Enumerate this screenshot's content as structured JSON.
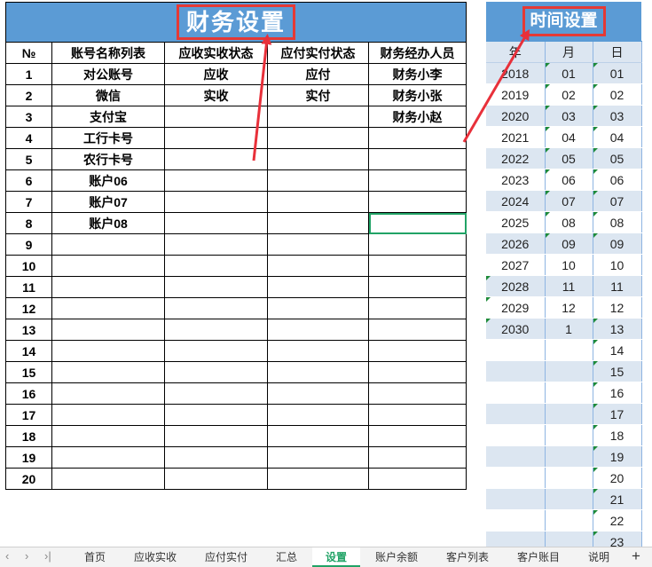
{
  "finance": {
    "title": "财务设置",
    "headers": [
      "№",
      "账号名称列表",
      "应收实收状态",
      "应付实付状态",
      "财务经办人员"
    ],
    "rows": [
      [
        "1",
        "对公账号",
        "应收",
        "应付",
        "财务小李"
      ],
      [
        "2",
        "微信",
        "实收",
        "实付",
        "财务小张"
      ],
      [
        "3",
        "支付宝",
        "",
        "",
        "财务小赵"
      ],
      [
        "4",
        "工行卡号",
        "",
        "",
        ""
      ],
      [
        "5",
        "农行卡号",
        "",
        "",
        ""
      ],
      [
        "6",
        "账户06",
        "",
        "",
        ""
      ],
      [
        "7",
        "账户07",
        "",
        "",
        ""
      ],
      [
        "8",
        "账户08",
        "",
        "",
        ""
      ],
      [
        "9",
        "",
        "",
        "",
        ""
      ],
      [
        "10",
        "",
        "",
        "",
        ""
      ],
      [
        "11",
        "",
        "",
        "",
        ""
      ],
      [
        "12",
        "",
        "",
        "",
        ""
      ],
      [
        "13",
        "",
        "",
        "",
        ""
      ],
      [
        "14",
        "",
        "",
        "",
        ""
      ],
      [
        "15",
        "",
        "",
        "",
        ""
      ],
      [
        "16",
        "",
        "",
        "",
        ""
      ],
      [
        "17",
        "",
        "",
        "",
        ""
      ],
      [
        "18",
        "",
        "",
        "",
        ""
      ],
      [
        "19",
        "",
        "",
        "",
        ""
      ],
      [
        "20",
        "",
        "",
        "",
        ""
      ]
    ]
  },
  "time": {
    "title": "时间设置",
    "headers": [
      "年",
      "月",
      "日"
    ],
    "rows": [
      [
        "2018",
        "01",
        "01"
      ],
      [
        "2019",
        "02",
        "02"
      ],
      [
        "2020",
        "03",
        "03"
      ],
      [
        "2021",
        "04",
        "04"
      ],
      [
        "2022",
        "05",
        "05"
      ],
      [
        "2023",
        "06",
        "06"
      ],
      [
        "2024",
        "07",
        "07"
      ],
      [
        "2025",
        "08",
        "08"
      ],
      [
        "2026",
        "09",
        "09"
      ],
      [
        "2027",
        "10",
        "10"
      ],
      [
        "2028",
        "11",
        "11"
      ],
      [
        "2029",
        "12",
        "12"
      ],
      [
        "2030",
        "1",
        "13"
      ],
      [
        "",
        "",
        "14"
      ],
      [
        "",
        "",
        "15"
      ],
      [
        "",
        "",
        "16"
      ],
      [
        "",
        "",
        "17"
      ],
      [
        "",
        "",
        "18"
      ],
      [
        "",
        "",
        "19"
      ],
      [
        "",
        "",
        "20"
      ],
      [
        "",
        "",
        "21"
      ],
      [
        "",
        "",
        "22"
      ],
      [
        "",
        "",
        "23"
      ]
    ]
  },
  "sheet_tabs": [
    "首页",
    "应收实收",
    "应付实付",
    "汇总",
    "设置",
    "账户余额",
    "客户列表",
    "客户账目",
    "说明"
  ],
  "active_tab": "设置",
  "add_sheet": "+",
  "colors": {
    "header_blue": "#5b9bd5",
    "title_outline_red": "#e53935",
    "stripe_blue": "#dce6f1",
    "active_tab_green": "#21a366",
    "arrow_red": "#e8303a"
  }
}
